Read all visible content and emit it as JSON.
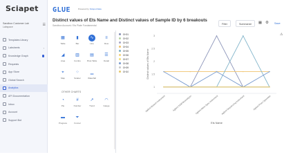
{
  "app": {
    "logo": "Sciapet",
    "brand": "GLUE",
    "brand_tag": "Powered by",
    "brand_tag_link": "Scispot Data"
  },
  "workspace": {
    "name": "Sandbox Customer Lab",
    "sub": "Labspace"
  },
  "sidebar": {
    "items": [
      {
        "label": "Templates Library",
        "icon": "library-icon",
        "active": false
      },
      {
        "label": "Labsheets",
        "icon": "sheet-icon",
        "active": false,
        "chevron": true
      },
      {
        "label": "Knowledge Graph",
        "icon": "graph-icon",
        "active": false,
        "badge": true
      },
      {
        "label": "Requests",
        "icon": "request-icon",
        "active": false
      },
      {
        "label": "App Store",
        "icon": "app-store-icon",
        "active": false
      },
      {
        "label": "Global Search",
        "icon": "search-icon",
        "active": false
      },
      {
        "label": "Analytics",
        "icon": "analytics-icon",
        "active": true
      },
      {
        "label": "API Documentation",
        "icon": "api-icon",
        "active": false
      },
      {
        "label": "Inbox",
        "icon": "inbox-icon",
        "active": false
      },
      {
        "label": "Account",
        "icon": "account-icon",
        "active": false
      },
      {
        "label": "Support Bot",
        "icon": "bot-icon",
        "active": false
      }
    ]
  },
  "header": {
    "title": "Distinct values of Ets Name and Distinct values of Sample ID by 6 breakouts",
    "subtitle": "Sandbox Account / Ets Plate Fundamental",
    "filter": "Filter",
    "summarize": "Summarize",
    "save": "Save"
  },
  "chart_types": {
    "items": [
      {
        "label": "Table",
        "icon": "table-icon",
        "glyph": "▦"
      },
      {
        "label": "Bar",
        "icon": "bar-chart-icon",
        "glyph": "▮"
      },
      {
        "label": "Line",
        "icon": "line-chart-icon",
        "glyph": "∿",
        "selected": true
      },
      {
        "label": "Row",
        "icon": "row-chart-icon",
        "glyph": "≡"
      },
      {
        "label": "Area",
        "icon": "area-chart-icon",
        "glyph": "◢"
      },
      {
        "label": "Combo",
        "icon": "combo-chart-icon",
        "glyph": "▥"
      },
      {
        "label": "Pivot Table",
        "icon": "pivot-icon",
        "glyph": "▤"
      },
      {
        "label": "Detail",
        "icon": "detail-icon",
        "glyph": "☰"
      },
      {
        "label": "Map",
        "icon": "map-icon",
        "glyph": "⌖"
      },
      {
        "label": "Scatter",
        "icon": "scatter-icon",
        "glyph": "⁘"
      },
      {
        "label": "Waterfall",
        "icon": "waterfall-icon",
        "glyph": "▁"
      }
    ],
    "other_label": "OTHER CHARTS",
    "other": [
      {
        "label": "Pie",
        "icon": "pie-chart-icon",
        "glyph": "◔"
      },
      {
        "label": "Number",
        "icon": "number-icon",
        "glyph": "#"
      },
      {
        "label": "Trend",
        "icon": "trend-icon",
        "glyph": "↗"
      },
      {
        "label": "Gauge",
        "icon": "gauge-icon",
        "glyph": "◠"
      },
      {
        "label": "Progress",
        "icon": "progress-icon",
        "glyph": "▬"
      },
      {
        "label": "Funnel",
        "icon": "funnel-icon",
        "glyph": "⏷"
      }
    ]
  },
  "chart_data": {
    "type": "line",
    "x": [
      "Agilent Biotech Instrument",
      "Agilent 2100 Bioanalyzer",
      "Agilent Mass Spec Instrument",
      "Agilent Sequencing Instrument",
      "Agilent Flow Cytometer"
    ],
    "xlabel": "Ets Name",
    "ylabel": "Distinct values of Ets Name",
    "yticks": [
      1,
      1.5,
      2,
      2.5,
      3
    ],
    "ylim": [
      0.75,
      3.05
    ],
    "grid": false,
    "legend_position": "left",
    "series": [
      {
        "name": "GH01",
        "color": "#8a93b8",
        "values": [
          1,
          1,
          3,
          1,
          1
        ]
      },
      {
        "name": "GH02",
        "color": "#b7d3a4",
        "values": [
          1,
          1,
          1,
          1,
          1
        ]
      },
      {
        "name": "GH03",
        "color": "#a9a9c6",
        "values": [
          1,
          1,
          1,
          1,
          1
        ]
      },
      {
        "name": "GH04",
        "color": "#f0c36d",
        "values": [
          1.6,
          1.6,
          1.6,
          1.6,
          1.6
        ]
      },
      {
        "name": "GH05",
        "color": "#7fb3c9",
        "values": [
          1,
          1,
          1,
          3,
          1
        ]
      },
      {
        "name": "GH06",
        "color": "#f3d27b",
        "values": [
          1,
          1,
          1,
          1,
          1
        ]
      },
      {
        "name": "GH07",
        "color": "#f2e07a",
        "values": [
          1,
          1,
          1,
          1,
          1
        ]
      },
      {
        "name": "GH08",
        "color": "#7a9ccf",
        "values": [
          1.6,
          1,
          1.6,
          1,
          1.6
        ]
      },
      {
        "name": "GH09",
        "color": "#c9c9c9",
        "values": [
          1,
          1,
          1,
          1,
          1
        ]
      },
      {
        "name": "GH10",
        "color": "#e6c86e",
        "values": [
          1,
          1,
          1,
          1,
          1
        ]
      }
    ]
  }
}
